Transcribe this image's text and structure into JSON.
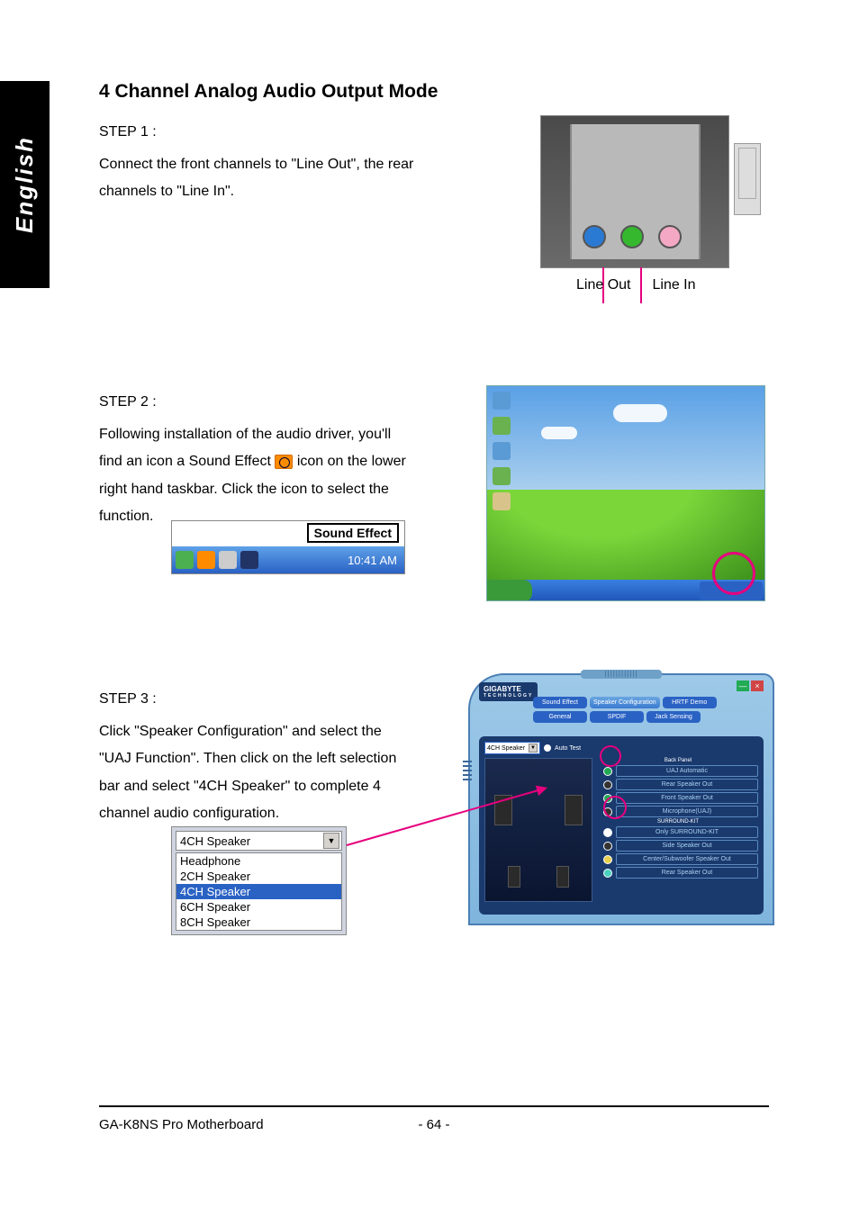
{
  "sidebar": {
    "label": "English"
  },
  "title": "4 Channel Analog Audio Output Mode",
  "step1": {
    "label": "STEP 1 :",
    "body": "Connect the front channels to \"Line Out\", the rear channels to \"Line In\".",
    "labels": {
      "out": "Line Out",
      "in": "Line In"
    }
  },
  "step2": {
    "label": "STEP 2 :",
    "body_a": "Following installation of the audio driver, you'll find an icon a Sound Effect ",
    "body_b": " icon on the lower right hand taskbar.  Click the icon to select the function.",
    "tooltip": "Sound Effect",
    "tray_time": "10:41 AM"
  },
  "step3": {
    "label": "STEP 3 :",
    "body": "Click \"Speaker Configuration\" and select the \"UAJ Function\".  Then click on the left selection bar and select \"4CH Speaker\" to complete 4 channel audio configuration.",
    "dropdown": {
      "selected": "4CH Speaker",
      "options": [
        "Headphone",
        "2CH Speaker",
        "4CH Speaker",
        "6CH Speaker",
        "8CH Speaker"
      ]
    }
  },
  "config": {
    "brand": "GIGABYTE",
    "brand_sub": "TECHNOLOGY",
    "tabs": [
      "Sound Effect",
      "Speaker Configuration",
      "HRTF Demo",
      "General",
      "SPDIF",
      "Jack Sensing"
    ],
    "select": "4CH Speaker",
    "auto_test": "Auto Test",
    "back_panel": "Back Panel",
    "uaj": "UAJ Automatic",
    "rear": "Rear Speaker Out",
    "front": "Front Speaker Out",
    "mic": "Microphone(UAJ)",
    "surround_label": "SURROUND-KIT",
    "surround": "Only SURROUND-KIT",
    "side": "Side Speaker Out",
    "center": "Center/Subwoofer Speaker Out",
    "rear2": "Rear Speaker Out"
  },
  "footer": {
    "left": "GA-K8NS Pro Motherboard",
    "center": "- 64 -"
  }
}
